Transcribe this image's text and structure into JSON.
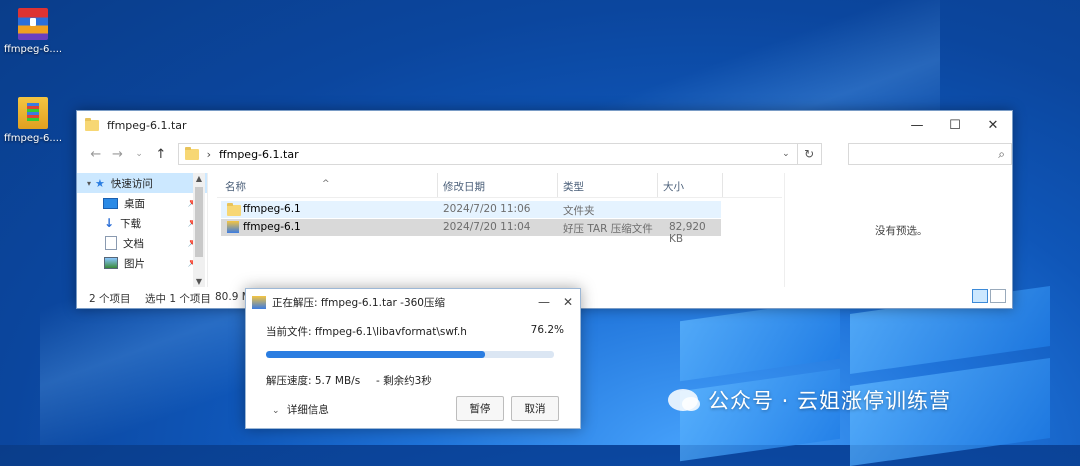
{
  "desktop": {
    "icons": [
      {
        "label": "ffmpeg-6...."
      },
      {
        "label": "ffmpeg-6...."
      }
    ]
  },
  "explorer": {
    "title": "ffmpeg-6.1.tar",
    "address": "ffmpeg-6.1.tar",
    "sidebar": [
      {
        "label": "快速访问"
      },
      {
        "label": "桌面"
      },
      {
        "label": "下载"
      },
      {
        "label": "文档"
      },
      {
        "label": "图片"
      }
    ],
    "columns": {
      "name": "名称",
      "modified": "修改日期",
      "type": "类型",
      "size": "大小"
    },
    "rows": [
      {
        "name": "ffmpeg-6.1",
        "modified": "2024/7/20 11:06",
        "type": "文件夹",
        "size": ""
      },
      {
        "name": "ffmpeg-6.1",
        "modified": "2024/7/20 11:04",
        "type": "好压 TAR 压缩文件",
        "size": "82,920 KB"
      }
    ],
    "preview_text": "没有预选。",
    "status": {
      "count": "2 个项目",
      "selected": "选中 1 个项目",
      "size": "80.9 M"
    }
  },
  "dialog": {
    "title": "正在解压: ffmpeg-6.1.tar -360压缩",
    "current_file": "当前文件: ffmpeg-6.1\\libavformat\\swf.h",
    "percent": "76.2%",
    "progress": 0.762,
    "speed": "解压速度: 5.7 MB/s",
    "remaining": "- 剩余约3秒",
    "details_label": "详细信息",
    "pause_label": "暂停",
    "cancel_label": "取消"
  },
  "watermark": {
    "text": "公众号 · 云姐涨停训练营"
  }
}
